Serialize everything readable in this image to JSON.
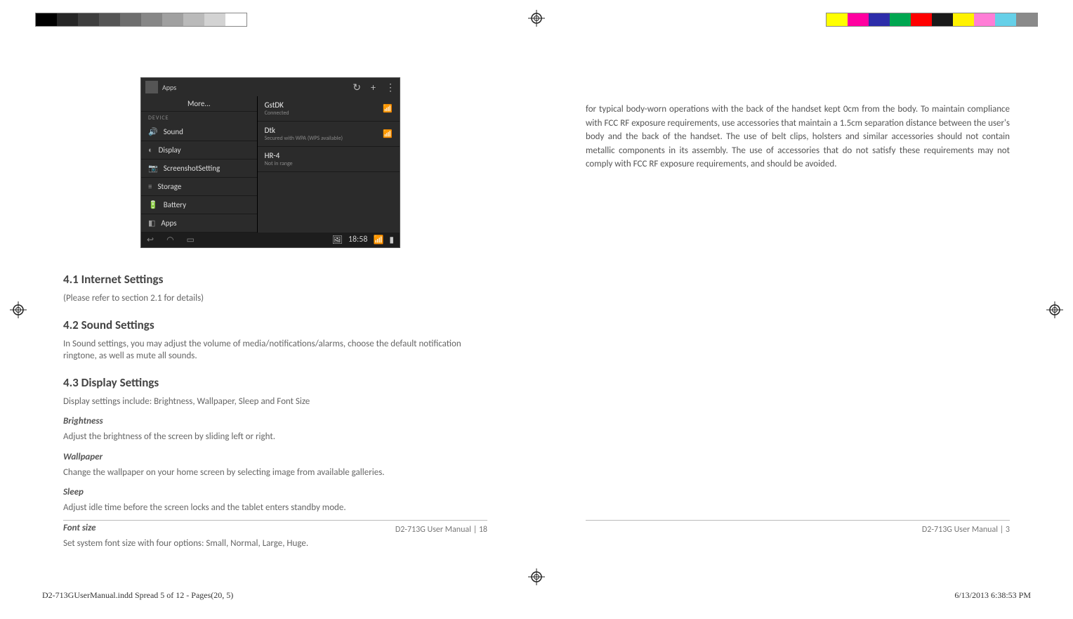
{
  "colorbars": {
    "left": [
      "#000000",
      "#262626",
      "#3e3e3e",
      "#555555",
      "#6e6e6e",
      "#878787",
      "#a0a0a0",
      "#bababa",
      "#d3d3d3",
      "#ffffff"
    ],
    "right": [
      "#ffff00",
      "#ff00a0",
      "#2d2daa",
      "#00a650",
      "#ff0000",
      "#1a1a1a",
      "#fff200",
      "#ff7dd6",
      "#66d0e8",
      "#8a8a8a"
    ]
  },
  "screenshot": {
    "topLabel": "Apps",
    "topIcons": {
      "refresh": "↻",
      "add": "+",
      "more": "⋮"
    },
    "left": {
      "more": "More...",
      "hdr": "DEVICE",
      "items": [
        {
          "icon": "🔊",
          "label": "Sound"
        },
        {
          "icon": "◐",
          "label": "Display"
        },
        {
          "icon": "📷",
          "label": "ScreenshotSetting"
        },
        {
          "icon": "≡",
          "label": "Storage"
        },
        {
          "icon": "🔋",
          "label": "Battery"
        },
        {
          "icon": "◧",
          "label": "Apps"
        }
      ]
    },
    "right": {
      "networks": [
        {
          "name": "GstDK",
          "sub": "Connected",
          "signal": "📶"
        },
        {
          "name": "Dtk",
          "sub": "Secured with WPA (WPS available)",
          "signal": "📶"
        },
        {
          "name": "HR-4",
          "sub": "Not in range",
          "signal": ""
        }
      ]
    },
    "bottom": {
      "back": "↩",
      "home": "◠",
      "recent": "▭",
      "status": {
        "img": "🖼",
        "time": "18:58",
        "wifi": "📶",
        "batt": "▮"
      }
    }
  },
  "leftPage": {
    "sec41_h": "4.1 Internet Settings",
    "sec41_p": "(Please refer to section 2.1 for details)",
    "sec42_h": "4.2 Sound Settings",
    "sec42_p": "In Sound settings, you may adjust the volume of media/notifications/alarms, choose the default notification ringtone, as well as mute all sounds.",
    "sec43_h": "4.3 Display Settings",
    "sec43_p": "Display settings include: Brightness, Wallpaper, Sleep and Font Size",
    "brightness_h": "Brightness",
    "brightness_p": "Adjust the brightness of the screen by sliding left or right.",
    "wallpaper_h": "Wallpaper",
    "wallpaper_p": "Change the wallpaper on your home screen by selecting image from available galleries.",
    "sleep_h": "Sleep",
    "sleep_p": "Adjust idle time before the screen locks and the tablet enters standby mode.",
    "font_h": "Font size",
    "font_p": "Set system font size with four options: Small, Normal, Large, Huge.",
    "footer": "D2-713G User Manual | 18"
  },
  "rightPage": {
    "body": "for typical body-worn operations with the back of the handset kept 0cm from the body. To maintain compliance with FCC RF exposure requirements, use accessories that maintain a 1.5cm separation distance between the user's body and the back of the handset. The use of belt clips, holsters and similar accessories should not contain metallic components in its assembly. The use of accessories that do not satisfy these requirements may not comply with FCC RF exposure requirements, and should be avoided.",
    "footer": "D2-713G User Manual | 3"
  },
  "sheet": {
    "left": "D2-713GUserManual.indd   Spread 5 of 12 - Pages(20, 5)",
    "right": "6/13/2013   6:38:53 PM"
  }
}
